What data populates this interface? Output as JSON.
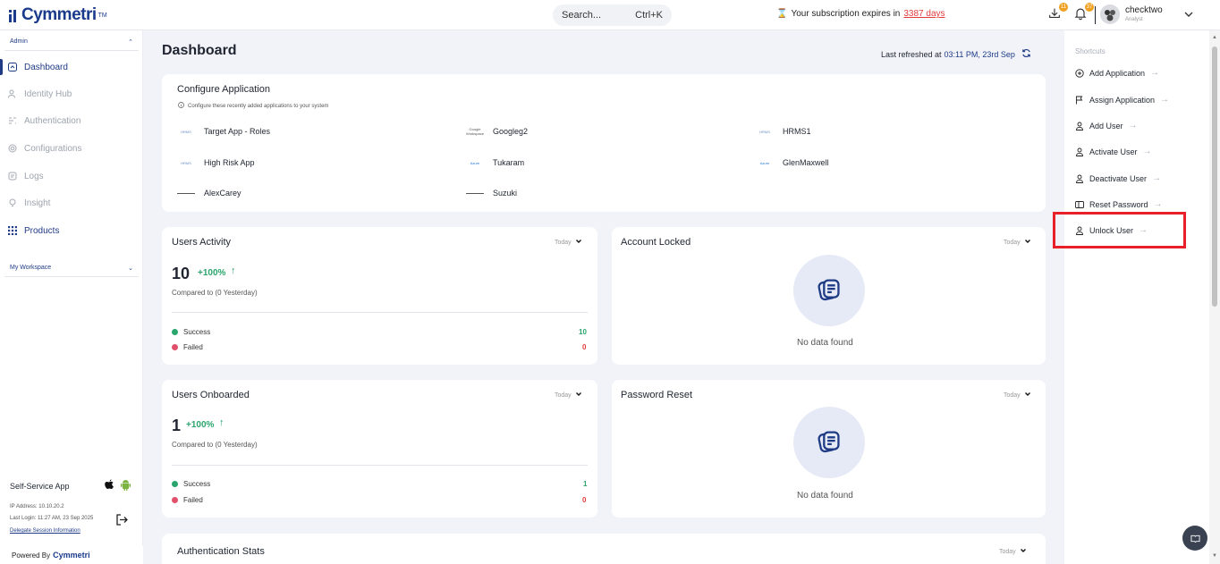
{
  "header": {
    "brand": "Cymmetri",
    "brand_tm": "TM",
    "search_placeholder": "Search...",
    "search_shortcut": "Ctrl+K",
    "subscription_prefix": "Your subscription expires in",
    "subscription_days": "3387 days",
    "downloads_badge": "11",
    "notifications_badge": "37",
    "user_name": "checktwo",
    "user_role": "Analyst"
  },
  "sidebar": {
    "group_admin": "Admin",
    "items": [
      {
        "label": "Dashboard",
        "icon": "dashboard-icon"
      },
      {
        "label": "Identity Hub",
        "icon": "identity-hub-icon"
      },
      {
        "label": "Authentication",
        "icon": "authentication-icon"
      },
      {
        "label": "Configurations",
        "icon": "gear-icon"
      },
      {
        "label": "Logs",
        "icon": "logs-icon"
      },
      {
        "label": "Insight",
        "icon": "insight-icon"
      },
      {
        "label": "Products",
        "icon": "grid-icon"
      }
    ],
    "group_workspace": "My Workspace",
    "self_service": "Self-Service App",
    "ip": "IP Address: 10.10.20.2",
    "last_login": "Last Login: 11:27 AM, 23 Sep 2025",
    "delegate": "Delegate Session Information",
    "powered_by": "Powered By",
    "powered_brand": "Cymmetri"
  },
  "main": {
    "title": "Dashboard",
    "last_refreshed_label": "Last refreshed at",
    "last_refreshed_time": "03:11 PM, 23rd Sep",
    "configure": {
      "title": "Configure Application",
      "subtitle": "Configure these recently added applications to your system",
      "apps": [
        {
          "name": "Target App - Roles",
          "logo": "HRMS"
        },
        {
          "name": "Googleg2",
          "logo": "Google Workspace"
        },
        {
          "name": "HRMS1",
          "logo": "HRMS"
        },
        {
          "name": "High Risk App",
          "logo": "HRMS"
        },
        {
          "name": "Tukaram",
          "logo": "Azure"
        },
        {
          "name": "GlenMaxwell",
          "logo": "Azure"
        },
        {
          "name": "AlexCarey",
          "logo": ""
        },
        {
          "name": "Suzuki",
          "logo": ""
        }
      ]
    },
    "users_activity": {
      "title": "Users Activity",
      "filter": "Today",
      "count": "10",
      "change": "+100%",
      "compared": "Compared to (0 Yesterday)",
      "success_label": "Success",
      "success_value": "10",
      "failed_label": "Failed",
      "failed_value": "0"
    },
    "account_locked": {
      "title": "Account Locked",
      "filter": "Today",
      "empty": "No data found"
    },
    "users_onboarded": {
      "title": "Users Onboarded",
      "filter": "Today",
      "count": "1",
      "change": "+100%",
      "compared": "Compared to (0 Yesterday)",
      "success_label": "Success",
      "success_value": "1",
      "failed_label": "Failed",
      "failed_value": "0"
    },
    "password_reset": {
      "title": "Password Reset",
      "filter": "Today",
      "empty": "No data found"
    },
    "auth_stats": {
      "title": "Authentication Stats",
      "filter": "Today"
    }
  },
  "shortcuts": {
    "heading": "Shortcuts",
    "items": [
      {
        "label": "Add Application",
        "icon": "plus-circle-icon"
      },
      {
        "label": "Assign Application",
        "icon": "flag-icon"
      },
      {
        "label": "Add User",
        "icon": "user-icon"
      },
      {
        "label": "Activate User",
        "icon": "user-icon"
      },
      {
        "label": "Deactivate User",
        "icon": "user-icon"
      },
      {
        "label": "Reset Password",
        "icon": "reset-icon"
      },
      {
        "label": "Unlock User",
        "icon": "user-icon"
      }
    ]
  },
  "colors": {
    "brand": "#1a3a8c",
    "success": "#2aa56b",
    "failed": "#e23b3b",
    "highlight": "#e8202a"
  }
}
